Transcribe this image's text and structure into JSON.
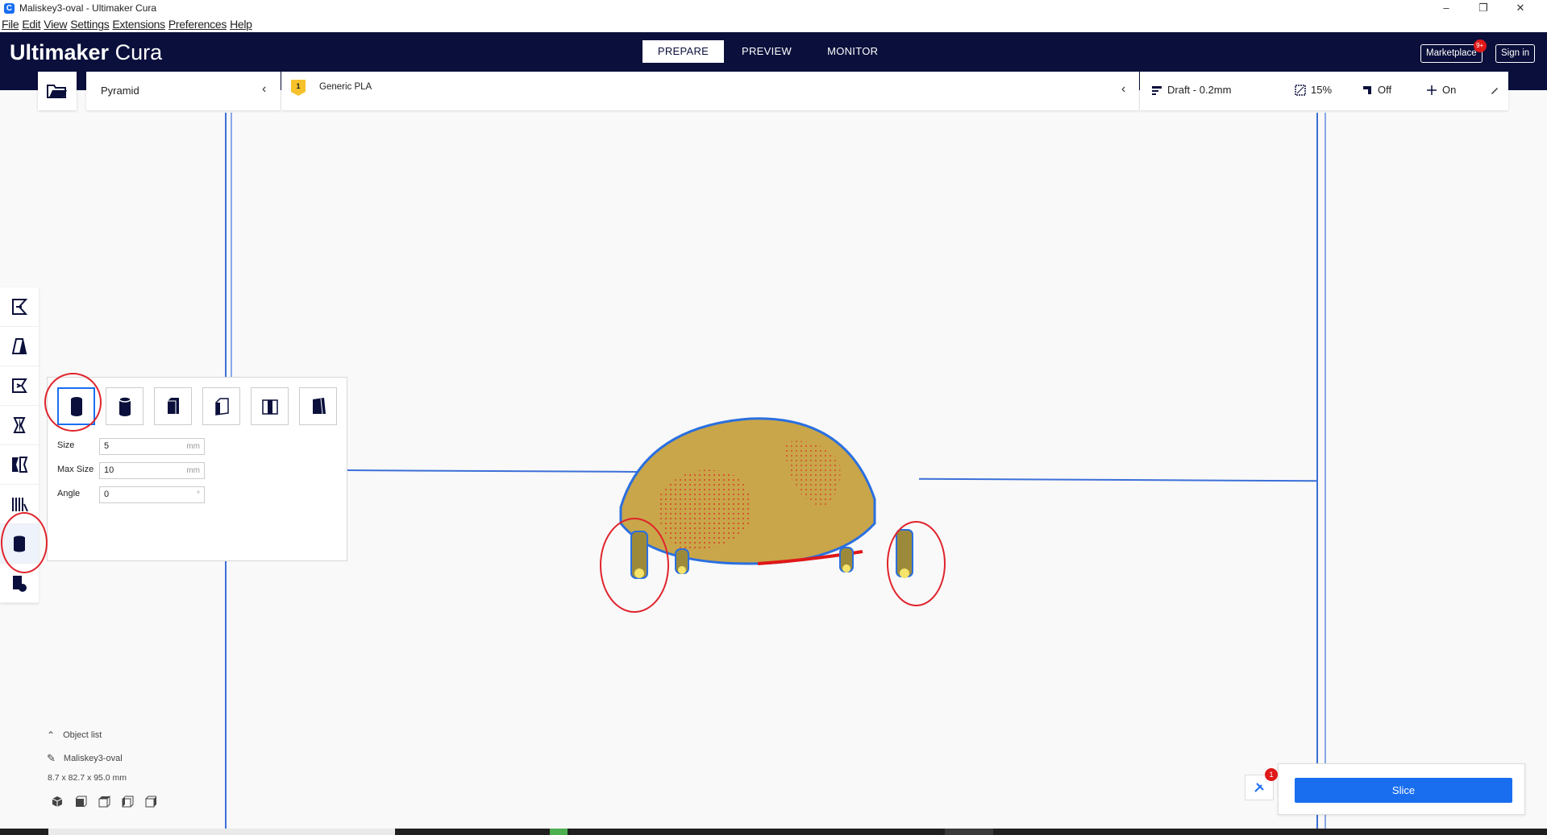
{
  "window": {
    "title": "Maliskey3-oval - Ultimaker Cura",
    "controls": [
      "–",
      "❐",
      "✕"
    ]
  },
  "menu": [
    "File",
    "Edit",
    "View",
    "Settings",
    "Extensions",
    "Preferences",
    "Help"
  ],
  "header": {
    "brand_bold": "Ultimaker",
    "brand_light": " Cura",
    "tabs": [
      "PREPARE",
      "PREVIEW",
      "MONITOR"
    ],
    "marketplace_label": "Marketplace",
    "marketplace_badge": "9+",
    "signin_label": "Sign in"
  },
  "printer": {
    "name": "Pyramid"
  },
  "material": {
    "extruder": "1",
    "name": "Generic PLA"
  },
  "print_settings": {
    "profile": "Draft - 0.2mm",
    "infill": "15%",
    "support": "Off",
    "adhesion": "On"
  },
  "support_blocker_panel": {
    "size_label": "Size",
    "size_value": "5",
    "size_unit": "mm",
    "max_size_label": "Max Size",
    "max_size_value": "10",
    "max_size_unit": "mm",
    "angle_label": "Angle",
    "angle_value": "0",
    "angle_unit": "°"
  },
  "object_list": {
    "toggle_label": "Object list",
    "object_name": "Maliskey3-oval",
    "dimensions": "8.7 x 82.7 x 95.0 mm"
  },
  "slice": {
    "label": "Slice",
    "message_count": "1"
  },
  "colors": {
    "header_bg": "#0a0f3b",
    "accent": "#196ef0",
    "build_volume_line": "#3c6fd8",
    "model_fill": "#c9a64a",
    "overhang": "#e01818",
    "annotation_circle": "#e0232b"
  }
}
